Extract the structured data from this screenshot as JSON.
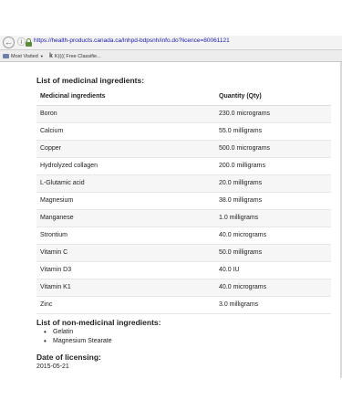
{
  "browser": {
    "url": "https://health-products.canada.ca/lnhpd-bdpsnh/info.do?licence=80061121",
    "bookmarks": [
      {
        "label": "Most Visited"
      },
      {
        "label": "K(((( Free Classifie..."
      }
    ]
  },
  "page": {
    "medicinal_title": "List of medicinal ingredients:",
    "table": {
      "headers": [
        "Medicinal ingredients",
        "Quantity (Qty)"
      ],
      "rows": [
        {
          "name": "Boron",
          "qty": "230.0 micrograms"
        },
        {
          "name": "Calcium",
          "qty": "55.0 milligrams"
        },
        {
          "name": "Copper",
          "qty": "500.0 micrograms"
        },
        {
          "name": "Hydrolyzed collagen",
          "qty": "200.0 milligrams"
        },
        {
          "name": "L-Glutamic acid",
          "qty": "20.0 milligrams"
        },
        {
          "name": "Magnesium",
          "qty": "38.0 milligrams"
        },
        {
          "name": "Manganese",
          "qty": "1.0 milligrams"
        },
        {
          "name": "Strontium",
          "qty": "40.0 micrograms"
        },
        {
          "name": "Vitamin C",
          "qty": "50.0 milligrams"
        },
        {
          "name": "Vitamin D3",
          "qty": "40.0 IU"
        },
        {
          "name": "Vitamin K1",
          "qty": "40.0 micrograms"
        },
        {
          "name": "Zinc",
          "qty": "3.0 milligrams"
        }
      ]
    },
    "non_medicinal_title": "List of non-medicinal ingredients:",
    "non_medicinal": [
      "Gelatin",
      "Magnesium Stearate"
    ],
    "licensing_title": "Date of licensing:",
    "licensing_date": "2015-05-21"
  }
}
